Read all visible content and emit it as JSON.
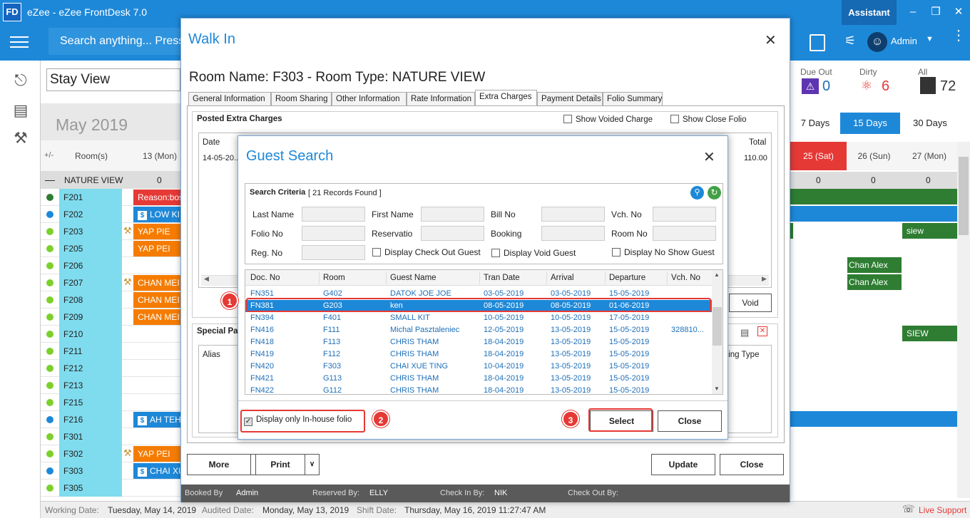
{
  "app": {
    "logo": "FD",
    "title": "eZee - eZee FrontDesk 7.0",
    "assistant": "Assistant",
    "admin": "Admin",
    "search_placeholder": "Search anything... Press"
  },
  "stay_view": {
    "selector": "Stay View",
    "month": "May 2019",
    "plus_minus": "+/-",
    "rooms_header": "Room(s)",
    "col_13": "13 (Mon)",
    "nature_view": "NATURE VIEW",
    "nature_count": "0",
    "rooms": [
      "F201",
      "F202",
      "F203",
      "F205",
      "F206",
      "F207",
      "F208",
      "F209",
      "F210",
      "F211",
      "F212",
      "F213",
      "F215",
      "F216",
      "F301",
      "F302",
      "F303",
      "F305"
    ],
    "bookings": [
      "Reason:bos",
      "LOW KI",
      "YAP PIE",
      "YAP PEI",
      "CHAN MEI",
      "CHAN MEI",
      "CHAN MEI",
      "AH TEH",
      "YAP PEI",
      "CHAI XU"
    ],
    "due_out_label": "Due Out",
    "due_out": "0",
    "dirty_label": "Dirty",
    "dirty": "6",
    "all_label": "All",
    "all": "72",
    "range_tabs": [
      "7 Days",
      "15 Days",
      "30 Days"
    ],
    "days": [
      "25 (Sat)",
      "26 (Sun)",
      "27 (Mon)"
    ],
    "day_counts": [
      "0",
      "0",
      "0"
    ],
    "right_bookings": [
      "siew",
      "Chan Alex",
      "Chan Alex",
      "SIEW"
    ]
  },
  "walkin": {
    "title": "Walk In",
    "room_heading": "Room Name: F303 - Room Type: NATURE VIEW",
    "tabs": [
      "General Information",
      "Room Sharing",
      "Other Information",
      "Rate Information",
      "Extra Charges",
      "Payment Details",
      "Folio Summary"
    ],
    "posted_extra": "Posted Extra Charges",
    "show_voided": "Show Voided Charge",
    "show_close_folio": "Show Close Folio",
    "date_col": "Date",
    "date_val": "14-05-20..",
    "total_col": "Total",
    "total_val": "110.00",
    "void": "Void",
    "special_pack": "Special Pac",
    "alias": "Alias",
    "ting_type": "ting Type",
    "more": "More",
    "print": "Print",
    "update": "Update",
    "close": "Close",
    "booked_by_label": "Booked By",
    "booked_by": "Admin",
    "reserved_by_label": "Reserved By:",
    "reserved_by": "ELLY",
    "checkin_by_label": "Check In By:",
    "checkin_by": "NIK",
    "checkout_by_label": "Check Out By:"
  },
  "guest_search": {
    "title": "Guest Search",
    "criteria": "Search Criteria",
    "records": "[ 21 Records Found ]",
    "labels": {
      "last_name": "Last Name",
      "first_name": "First Name",
      "bill_no": "Bill No",
      "vch_no": "Vch. No",
      "folio_no": "Folio No",
      "reservation": "Reservatio",
      "booking": "Booking",
      "room_no": "Room No",
      "reg_no": "Reg. No"
    },
    "display_checkout": "Display Check Out Guest",
    "display_void": "Display Void Guest",
    "display_noshow": "Display No Show Guest",
    "columns": [
      "Doc. No",
      "Room",
      "Guest Name",
      "Tran Date",
      "Arrival",
      "Departure",
      "Vch. No"
    ],
    "rows": [
      [
        "FN351",
        "G402",
        "DATOK JOE JOE",
        "03-05-2019",
        "03-05-2019",
        "15-05-2019",
        ""
      ],
      [
        "FN381",
        "G203",
        " ken",
        "08-05-2019",
        "08-05-2019",
        "01-06-2019",
        ""
      ],
      [
        "FN394",
        "F401",
        "SMALL KIT",
        "10-05-2019",
        "10-05-2019",
        "17-05-2019",
        ""
      ],
      [
        "FN416",
        "F111",
        "Michal Pasztaleniec",
        "12-05-2019",
        "13-05-2019",
        "15-05-2019",
        "328810..."
      ],
      [
        "FN418",
        "F113",
        " CHRIS THAM",
        "18-04-2019",
        "13-05-2019",
        "15-05-2019",
        ""
      ],
      [
        "FN419",
        "F112",
        " CHRIS THAM",
        "18-04-2019",
        "13-05-2019",
        "15-05-2019",
        ""
      ],
      [
        "FN420",
        "F303",
        "CHAI XUE TING",
        "10-04-2019",
        "13-05-2019",
        "15-05-2019",
        ""
      ],
      [
        "FN421",
        "G113",
        " CHRIS THAM",
        "18-04-2019",
        "13-05-2019",
        "15-05-2019",
        ""
      ],
      [
        "FN422",
        "G112",
        " CHRIS THAM",
        "18-04-2019",
        "13-05-2019",
        "15-05-2019",
        ""
      ]
    ],
    "inhouse": "Display only In-house folio",
    "select": "Select",
    "close": "Close",
    "markers": [
      "1",
      "2",
      "3"
    ]
  },
  "status": {
    "working_label": "Working Date:",
    "working": "Tuesday, May 14, 2019",
    "audited_label": "Audited Date:",
    "audited": "Monday, May 13, 2019",
    "shift_label": "Shift Date:",
    "shift": "Thursday, May 16, 2019 11:27:47 AM",
    "live_support": "Live Support"
  },
  "colors": {
    "accent": "#1e88d8",
    "orange": "#f57c00",
    "green": "#2e7d32",
    "red": "#e53935",
    "select_row": "#1e88d8"
  }
}
